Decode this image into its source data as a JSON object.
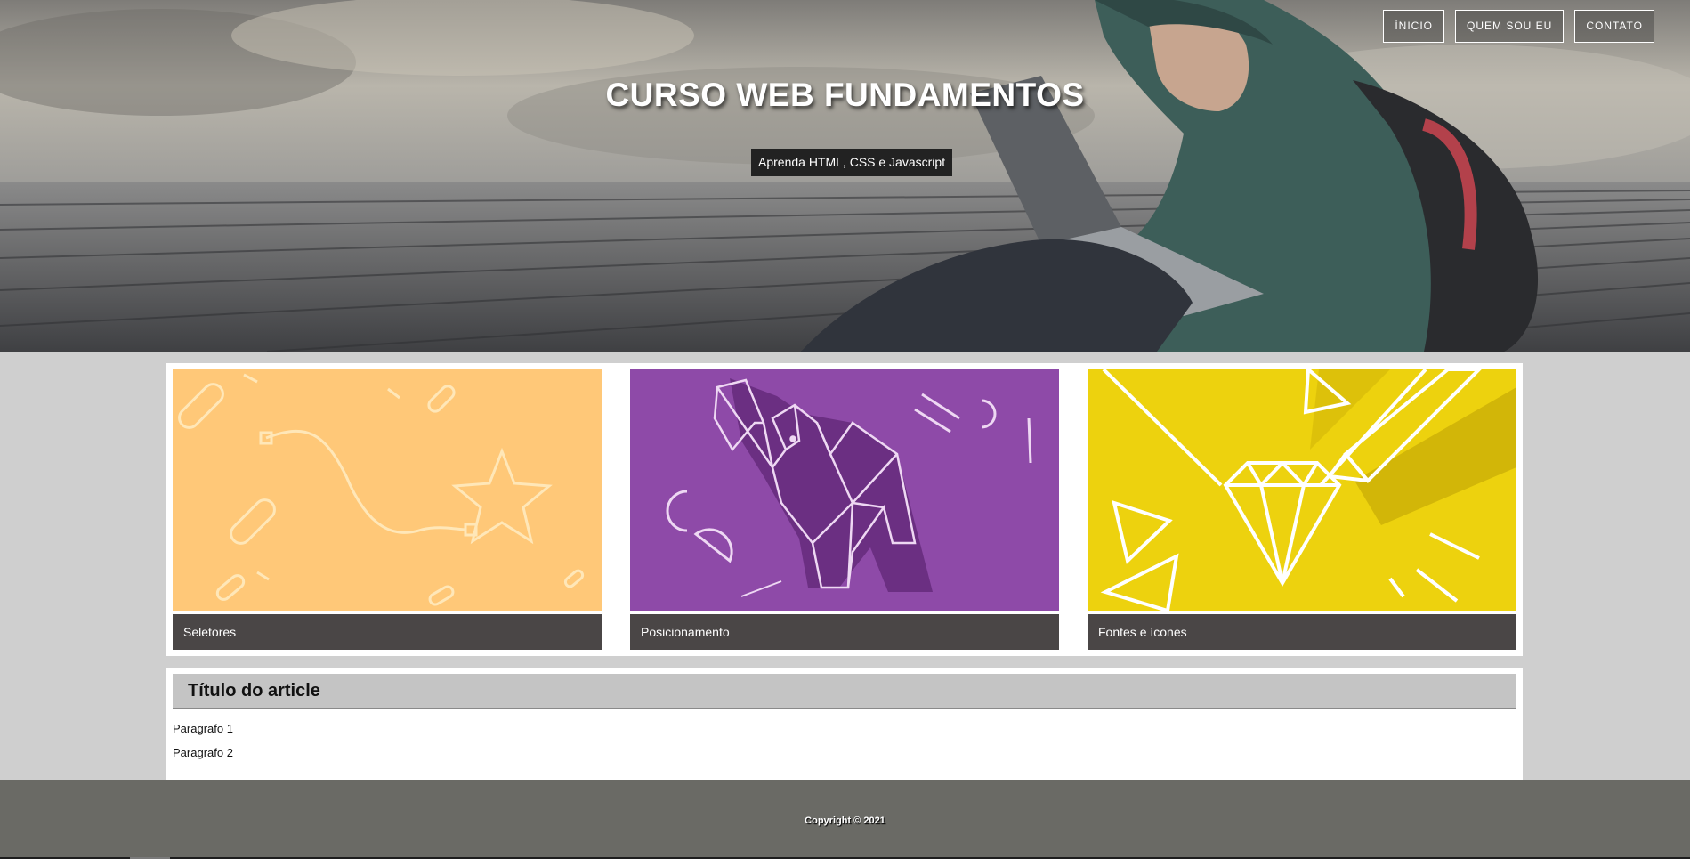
{
  "nav": {
    "items": [
      {
        "label": "ÍNICIO"
      },
      {
        "label": "QUEM SOU EU"
      },
      {
        "label": "CONTATO"
      }
    ]
  },
  "hero": {
    "title": "CURSO WEB FUNDAMENTOS",
    "subtitle": "Aprenda HTML, CSS e Javascript"
  },
  "cards": [
    {
      "caption": "Seletores",
      "color": "#ffc878",
      "illustration": "star-and-path"
    },
    {
      "caption": "Posicionamento",
      "color": "#8e4aa8",
      "illustration": "origami-elephant"
    },
    {
      "caption": "Fontes e ícones",
      "color": "#edd20e",
      "illustration": "diamond-and-pencil"
    }
  ],
  "article": {
    "title": "Título do article",
    "paragraphs": [
      "Paragrafo 1",
      "Paragrafo 2"
    ]
  },
  "footer": {
    "copyright": "Copyright © 2021"
  },
  "colors": {
    "card_caption_bg": "#4a4646",
    "footer_bg": "#6a6a65",
    "page_bg": "#cfcfcf"
  }
}
